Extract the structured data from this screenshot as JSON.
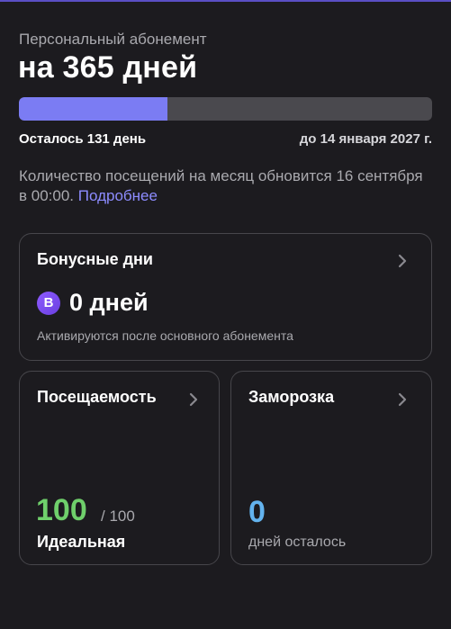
{
  "header": {
    "subtitle": "Персональный абонемент",
    "title": "на 365 дней"
  },
  "progress": {
    "fraction": 0.36,
    "remaining_label": "Осталось 131 день",
    "until_label": "до 14 января 2027 г."
  },
  "info": {
    "text": "Количество посещений на месяц обновится 16 сентября в 00:00.",
    "link": "Подробнее"
  },
  "bonus": {
    "title": "Бонусные дни",
    "badge": "B",
    "value": "0 дней",
    "note": "Активируются после основного абонемента"
  },
  "attendance": {
    "title": "Посещаемость",
    "value": "100",
    "max": "/ 100",
    "status": "Идеальная"
  },
  "freeze": {
    "title": "Заморозка",
    "value": "0",
    "label": "дней осталось"
  },
  "colors": {
    "background": "#1c1b1f",
    "accent": "#7b7cf3",
    "link": "#8d8cff",
    "attendance_value": "#6fcf6b",
    "freeze_value": "#63b3ee"
  },
  "icons": {
    "chevron": "chevron-right-icon"
  }
}
